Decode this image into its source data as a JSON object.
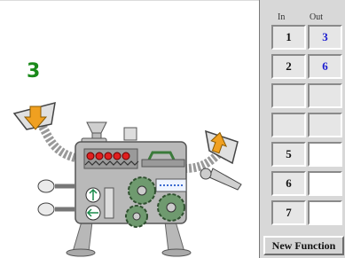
{
  "display": {
    "current_value": "3"
  },
  "table": {
    "header_in": "In",
    "header_out": "Out",
    "rows": [
      {
        "in": "1",
        "out": "3"
      },
      {
        "in": "2",
        "out": "6"
      },
      {
        "in": "",
        "out": ""
      },
      {
        "in": "",
        "out": ""
      },
      {
        "in": "5",
        "out": ""
      },
      {
        "in": "6",
        "out": ""
      },
      {
        "in": "7",
        "out": ""
      }
    ]
  },
  "buttons": {
    "new_function": "New Function"
  },
  "colors": {
    "value_green": "#1a8a1a",
    "output_blue": "#1a1ad0",
    "arrow_orange": "#f0a020"
  },
  "icons": {
    "input_arrow": "down-arrow-icon",
    "output_arrow": "up-arrow-icon"
  }
}
